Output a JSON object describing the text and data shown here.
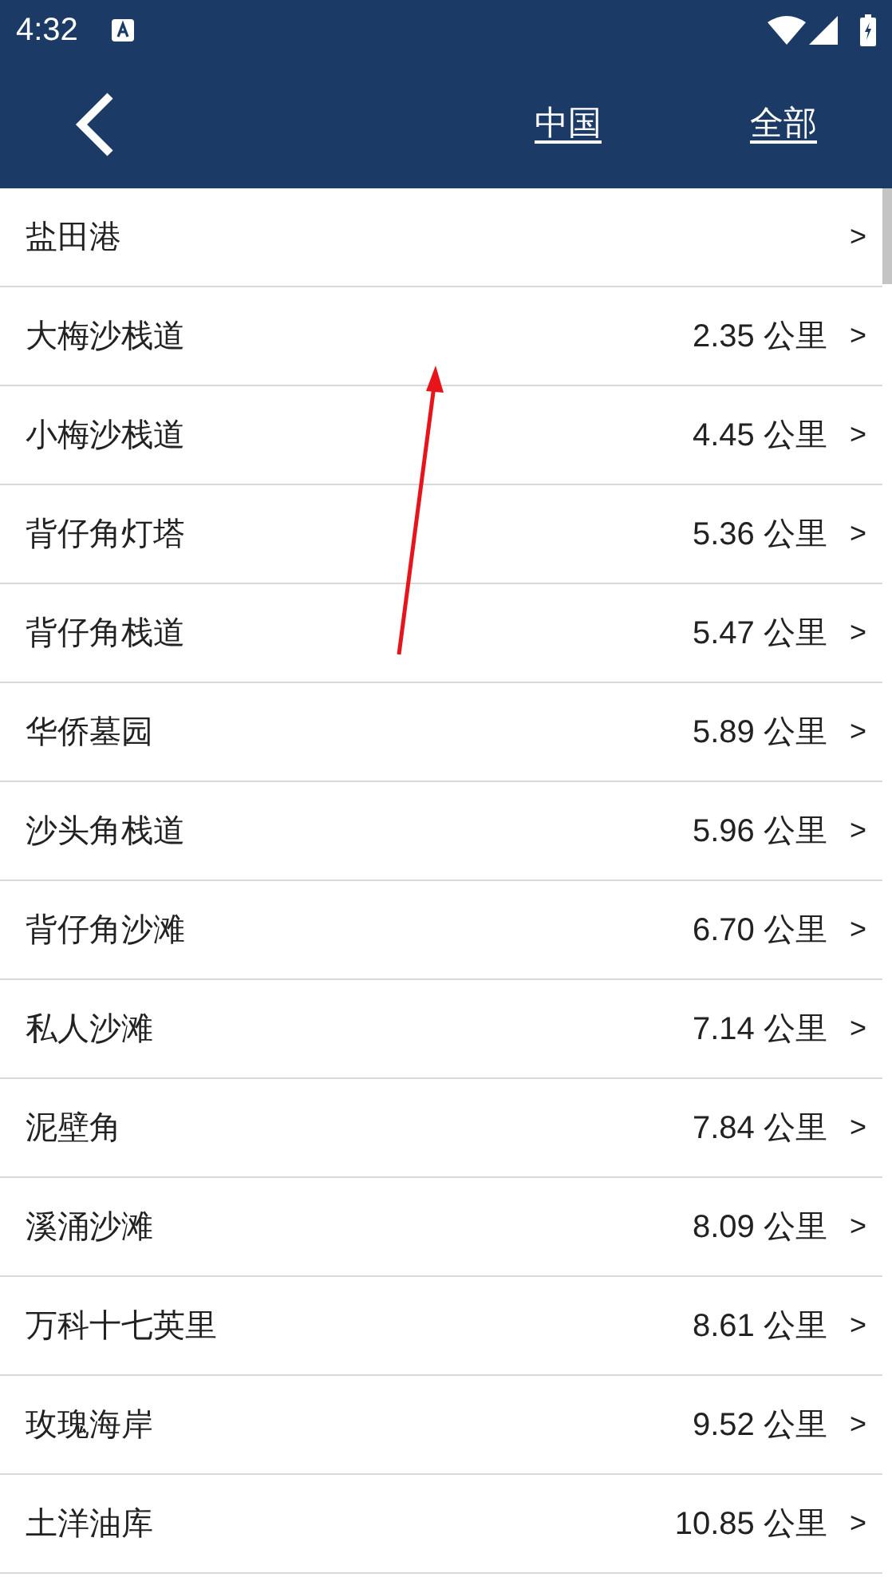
{
  "status_bar": {
    "time": "4:32"
  },
  "header": {
    "links": [
      "中国",
      "全部"
    ]
  },
  "places": [
    {
      "name": "盐田港",
      "arrow": ">"
    },
    {
      "name": "大梅沙栈道",
      "distance": "2.35 公里",
      "arrow": ">"
    },
    {
      "name": "小梅沙栈道",
      "distance": "4.45 公里",
      "arrow": ">"
    },
    {
      "name": "背仔角灯塔",
      "distance": "5.36 公里",
      "arrow": ">"
    },
    {
      "name": "背仔角栈道",
      "distance": "5.47 公里",
      "arrow": ">"
    },
    {
      "name": "华侨墓园",
      "distance": "5.89 公里",
      "arrow": ">"
    },
    {
      "name": "沙头角栈道",
      "distance": "5.96 公里",
      "arrow": ">"
    },
    {
      "name": "背仔角沙滩",
      "distance": "6.70 公里",
      "arrow": ">"
    },
    {
      "name": "私人沙滩",
      "distance": "7.14 公里",
      "arrow": ">"
    },
    {
      "name": "泥壁角",
      "distance": "7.84 公里",
      "arrow": ">"
    },
    {
      "name": "溪涌沙滩",
      "distance": "8.09 公里",
      "arrow": ">"
    },
    {
      "name": "万科十七英里",
      "distance": "8.61 公里",
      "arrow": ">"
    },
    {
      "name": "玫瑰海岸",
      "distance": "9.52 公里",
      "arrow": ">"
    },
    {
      "name": "土洋油库",
      "distance": "10.85 公里",
      "arrow": ">"
    }
  ]
}
